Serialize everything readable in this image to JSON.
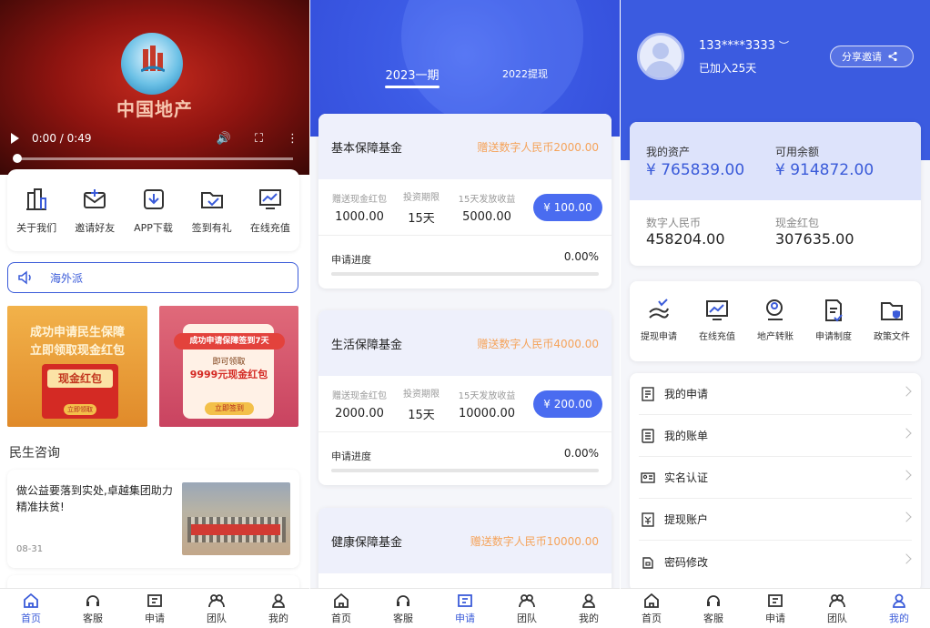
{
  "colors": {
    "brand": "#3a5bd9",
    "gift": "#f5a35a",
    "red": "#d42a24"
  },
  "panel1": {
    "video": {
      "logo_text": "中国地产",
      "time": "0:00 / 0:49"
    },
    "quick": [
      {
        "label": "关于我们",
        "icon": "building-icon"
      },
      {
        "label": "邀请好友",
        "icon": "envelope-icon"
      },
      {
        "label": "APP下载",
        "icon": "download-icon"
      },
      {
        "label": "签到有礼",
        "icon": "folder-check-icon"
      },
      {
        "label": "在线充值",
        "icon": "chart-yen-icon"
      }
    ],
    "notice": "海外派",
    "banner1": {
      "line1": "成功申请民生保障",
      "line2": "立即领取现金红包",
      "tag": "现金红包",
      "btn": "立即领取"
    },
    "banner2": {
      "head": "成功申请保障签到7天",
      "line1": "即可领取",
      "line2": "9999元现金红包",
      "btn": "立即签到"
    },
    "section_title": "民生咨询",
    "news": {
      "title": "做公益要落到实处,卓越集团助力精准扶贫!",
      "date": "08-31"
    }
  },
  "panel2": {
    "tabs": [
      "2023一期",
      "2022提现"
    ],
    "labels": {
      "k1": "赠送现金红包",
      "k2": "投资期限",
      "k3": "15天发放收益",
      "progress": "申请进度"
    },
    "funds": [
      {
        "name": "基本保障基金",
        "gift": "赠送数字人民币2000.00",
        "cash": "1000.00",
        "term": "15天",
        "income": "5000.00",
        "price": "¥ 100.00",
        "progress": "0.00%"
      },
      {
        "name": "生活保障基金",
        "gift": "赠送数字人民币4000.00",
        "cash": "2000.00",
        "term": "15天",
        "income": "10000.00",
        "price": "¥ 200.00",
        "progress": "0.00%"
      },
      {
        "name": "健康保障基金",
        "gift": "赠送数字人民币10000.00"
      }
    ]
  },
  "panel3": {
    "phone": "133****3333",
    "joined": "已加入25天",
    "share": "分享邀请",
    "assets": {
      "my_assets_label": "我的资产",
      "my_assets": "¥ 765839.00",
      "balance_label": "可用余额",
      "balance": "¥ 914872.00",
      "rmb_label": "数字人民币",
      "rmb": "458204.00",
      "cash_label": "现金红包",
      "cash": "307635.00"
    },
    "menu": [
      {
        "label": "提现申请",
        "icon": "withdraw-icon"
      },
      {
        "label": "在线充值",
        "icon": "chart-yen-icon"
      },
      {
        "label": "地产转账",
        "icon": "transfer-icon"
      },
      {
        "label": "申请制度",
        "icon": "document-icon"
      },
      {
        "label": "政策文件",
        "icon": "folder-shield-icon"
      }
    ],
    "list": [
      {
        "label": "我的申请",
        "icon": "application-icon"
      },
      {
        "label": "我的账单",
        "icon": "bill-icon"
      },
      {
        "label": "实名认证",
        "icon": "id-card-icon"
      },
      {
        "label": "提现账户",
        "icon": "account-icon"
      },
      {
        "label": "密码修改",
        "icon": "lock-icon"
      }
    ]
  },
  "tabbar": [
    "首页",
    "客服",
    "申请",
    "团队",
    "我的"
  ]
}
